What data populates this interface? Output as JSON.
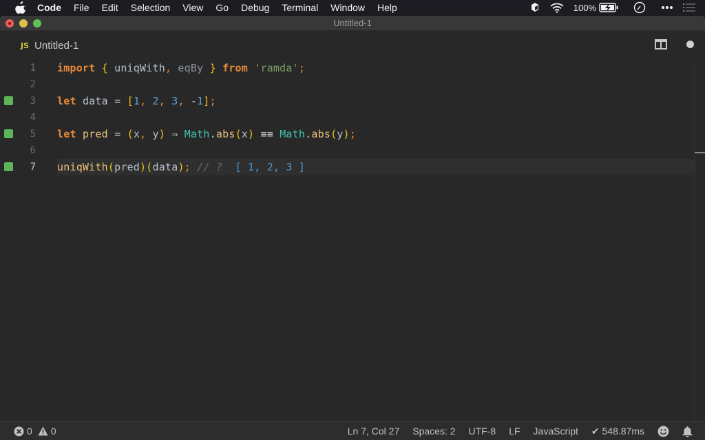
{
  "menubar": {
    "app_name": "Code",
    "items": [
      "File",
      "Edit",
      "Selection",
      "View",
      "Go",
      "Debug",
      "Terminal",
      "Window",
      "Help"
    ],
    "battery_percent": "100%",
    "icons": [
      "apple-logo-icon",
      "dropbox-icon",
      "wifi-icon",
      "battery-charging-icon",
      "clock-icon",
      "more-icon",
      "notification-center-icon"
    ]
  },
  "window": {
    "title": "Untitled-1"
  },
  "tab": {
    "icon_label": "JS",
    "label": "Untitled-1",
    "dirty": true
  },
  "editor": {
    "current_line": 7,
    "lines": [
      {
        "number": "1",
        "marker": false
      },
      {
        "number": "2",
        "marker": false
      },
      {
        "number": "3",
        "marker": true
      },
      {
        "number": "4",
        "marker": false
      },
      {
        "number": "5",
        "marker": true
      },
      {
        "number": "6",
        "marker": false
      },
      {
        "number": "7",
        "marker": true
      }
    ],
    "tokens": {
      "l1": {
        "import": "import",
        "lbrace": "{",
        "uniqWith": "uniqWith",
        "comma": ",",
        "eqBy": "eqBy",
        "rbrace": "}",
        "from": "from",
        "module": "'ramda'",
        "semi": ";"
      },
      "l3": {
        "let": "let",
        "name": "data",
        "eq": "=",
        "lbr": "[",
        "n1": "1",
        "n2": "2",
        "n3": "3",
        "minus": "-",
        "n4": "1",
        "rbr": "]",
        "semi": ";",
        "comma": ","
      },
      "l5": {
        "let": "let",
        "name": "pred",
        "eq": "=",
        "lp": "(",
        "x": "x",
        "comma": ",",
        "y": "y",
        "rp": ")",
        "arrow": "⇒",
        "math": "Math",
        "dot": ".",
        "abs": "abs",
        "strict_eq": "≡≡",
        "semi": ";"
      },
      "l7": {
        "fn": "uniqWith",
        "lp": "(",
        "arg1": "pred",
        "rp": ")",
        "arg2": "data",
        "semi": ";",
        "comment": "// ?",
        "result": "[ 1, 2, 3 ]"
      }
    },
    "marker_color": "#5eb458"
  },
  "statusbar": {
    "errors": "0",
    "warnings": "0",
    "position": "Ln 7, Col 27",
    "indent": "Spaces: 2",
    "encoding": "UTF-8",
    "eol": "LF",
    "language": "JavaScript",
    "timing": "✔ 548.87ms"
  }
}
